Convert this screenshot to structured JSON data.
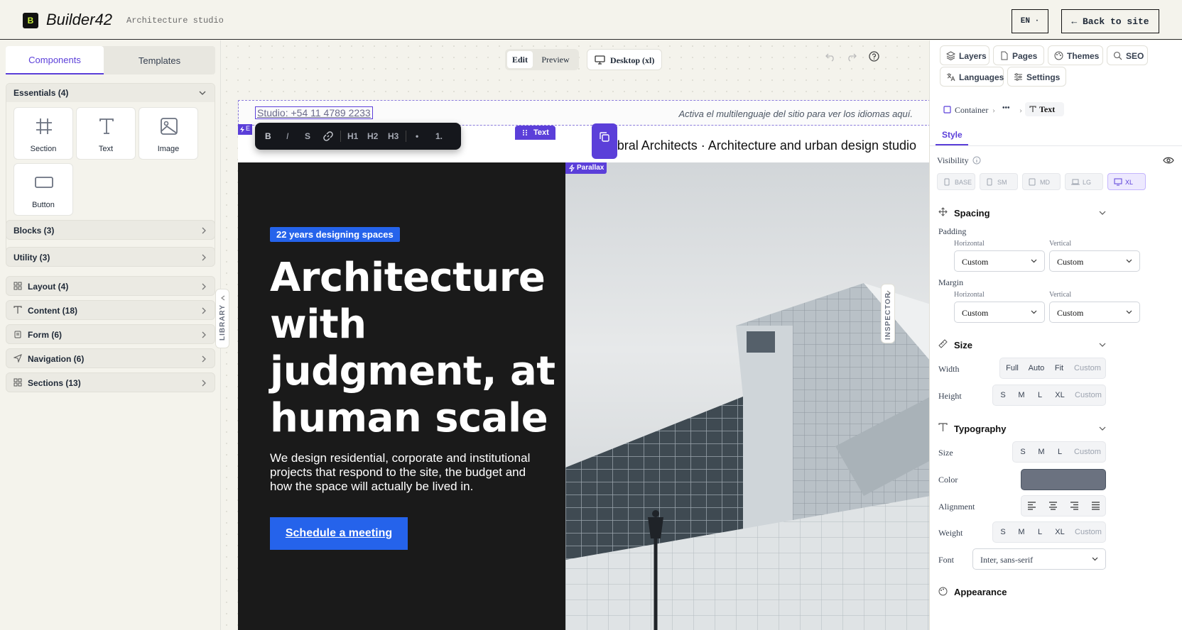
{
  "app": {
    "logo_letter": "B",
    "name": "Builder42",
    "subtitle": "Architecture studio",
    "lang_label": "EN ·",
    "back_label": "← Back to site"
  },
  "library": {
    "tabs": [
      {
        "label": "Components",
        "active": true
      },
      {
        "label": "Templates",
        "active": false
      }
    ],
    "essentials": {
      "title": "Essentials (4)",
      "items": [
        {
          "label": "Section",
          "icon": "grid-hash-icon"
        },
        {
          "label": "Text",
          "icon": "text-icon"
        },
        {
          "label": "Image",
          "icon": "image-icon"
        },
        {
          "label": "Button",
          "icon": "button-icon"
        }
      ]
    },
    "categories": [
      {
        "label": "Blocks (3)"
      },
      {
        "label": "Utility (3)"
      },
      {
        "label": "Layout (4)",
        "icon": "layout-grid-icon"
      },
      {
        "label": "Content (18)",
        "icon": "text-icon"
      },
      {
        "label": "Form (6)",
        "icon": "clipboard-icon"
      },
      {
        "label": "Navigation (6)",
        "icon": "navigation-icon"
      },
      {
        "label": "Sections (13)",
        "icon": "layout-grid-icon"
      }
    ],
    "handle_label": "LIBRARY"
  },
  "canvas": {
    "mode_tabs": [
      {
        "label": "Edit",
        "active": true
      },
      {
        "label": "Preview",
        "active": false
      }
    ],
    "device_label": "Desktop (xl)",
    "selected_tag": "Text",
    "small_tag": "E",
    "format_buttons": [
      "B",
      "I",
      "S",
      "H1",
      "H2",
      "H3",
      "•",
      "1."
    ],
    "studio_text": "Studio: +54 11 4789 2233",
    "multilang_note": "Activa el multilenguaje del sitio para ver los idiomas aquí.",
    "subheadline": "Umbral Architects · Architecture and urban design studio",
    "hero": {
      "badge": "22 years designing spaces",
      "headline": "Architecture with judgment, at human scale",
      "description": "We design residential, corporate and institutional projects that respond to the site, the budget and how the space will actually be lived in.",
      "cta": "Schedule a meeting",
      "image_tag": "Parallax"
    }
  },
  "inspector": {
    "tabs": [
      {
        "label": "Layers",
        "icon": "layers-icon"
      },
      {
        "label": "Pages",
        "icon": "page-icon"
      },
      {
        "label": "Themes",
        "icon": "palette-icon"
      },
      {
        "label": "SEO",
        "icon": "search-icon"
      },
      {
        "label": "Languages",
        "icon": "translate-icon"
      },
      {
        "label": "Settings",
        "icon": "sliders-icon"
      }
    ],
    "breadcrumb": [
      "Container",
      "•••",
      "Text"
    ],
    "style_tab": "Style",
    "visibility_label": "Visibility",
    "breakpoints": [
      {
        "label": "BASE",
        "active": false
      },
      {
        "label": "SM",
        "active": false
      },
      {
        "label": "MD",
        "active": false
      },
      {
        "label": "LG",
        "active": false
      },
      {
        "label": "XL",
        "active": true
      }
    ],
    "spacing": {
      "title": "Spacing",
      "padding_label": "Padding",
      "margin_label": "Margin",
      "horizontal_label": "Horizontal",
      "vertical_label": "Vertical",
      "padding_h": "Custom",
      "padding_v": "Custom",
      "margin_h": "Custom",
      "margin_v": "Custom"
    },
    "size": {
      "title": "Size",
      "width_label": "Width",
      "height_label": "Height",
      "width_options": [
        "Full",
        "Auto",
        "Fit",
        "Custom"
      ],
      "height_options": [
        "S",
        "M",
        "L",
        "XL",
        "Custom"
      ]
    },
    "typography": {
      "title": "Typography",
      "size_label": "Size",
      "size_options": [
        "S",
        "M",
        "L",
        "Custom"
      ],
      "color_label": "Color",
      "color_value": "#6b7280",
      "alignment_label": "Alignment",
      "weight_label": "Weight",
      "weight_options": [
        "S",
        "M",
        "L",
        "XL",
        "Custom"
      ],
      "font_label": "Font",
      "font_value": "Inter, sans-serif"
    },
    "appearance_title": "Appearance",
    "handle_label": "INSPECTOR"
  },
  "colors": {
    "accent": "#5b3fd9",
    "cta_blue": "#2563eb",
    "hero_dark": "#1a1a1a"
  }
}
